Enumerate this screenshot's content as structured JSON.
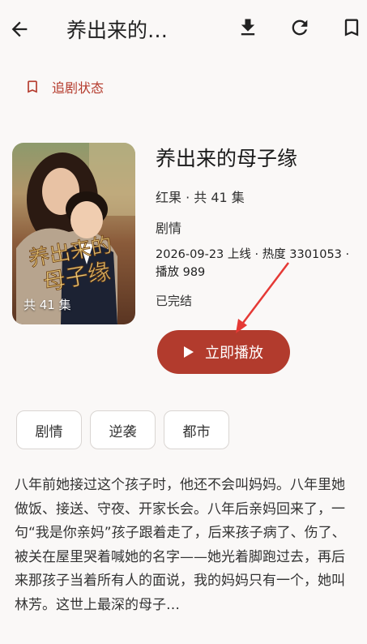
{
  "appbar": {
    "title": "养出来的…",
    "icons": [
      "arrow-left-icon",
      "download-icon",
      "refresh-icon",
      "bookmark-icon"
    ]
  },
  "follow": {
    "label": "追剧状态"
  },
  "cover": {
    "title_art": "养出来的母子缘",
    "episode_count": "共 41 集"
  },
  "drama": {
    "title": "养出来的母子缘",
    "source_episodes": "红果 · 共 41 集",
    "genre": "剧情",
    "stats": "2026-09-23 上线 · 热度 3301053 · 播放 989",
    "status": "已完结"
  },
  "play_button": {
    "label": "立即播放"
  },
  "tags": [
    "剧情",
    "逆袭",
    "都市"
  ],
  "description": "八年前她接过这个孩子时，他还不会叫妈妈。八年里她做饭、接送、守夜、开家长会。八年后亲妈回来了，一句“我是你亲妈”孩子跟着走了，后来孩子病了、伤了、被关在屋里哭着喊她的名字——她光着脚跑过去，再后来那孩子当着所有人的面说，我的妈妈只有一个，她叫林芳。这世上最深的母子…",
  "colors": {
    "accent": "#b23b2d",
    "background": "#faf8f7",
    "annotation_arrow": "#e53935"
  }
}
